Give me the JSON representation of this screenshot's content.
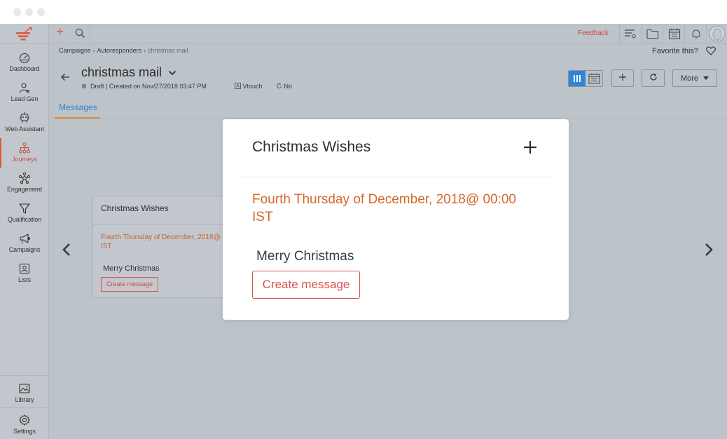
{
  "window": {},
  "sidebar": {
    "items": [
      {
        "label": "Dashboard",
        "icon": "dashboard-icon"
      },
      {
        "label": "Lead Gen",
        "icon": "lead-gen-icon"
      },
      {
        "label": "Web Assistant",
        "icon": "web-assistant-icon"
      },
      {
        "label": "Journeys",
        "icon": "journeys-icon",
        "active": true
      },
      {
        "label": "Engagement",
        "icon": "engagement-icon"
      },
      {
        "label": "Qualification",
        "icon": "funnel-icon"
      },
      {
        "label": "Campaigns",
        "icon": "megaphone-icon"
      },
      {
        "label": "Lists",
        "icon": "lists-icon"
      }
    ],
    "bottom": [
      {
        "label": "Library",
        "icon": "image-icon"
      },
      {
        "label": "Settings",
        "icon": "gear-icon"
      }
    ]
  },
  "topbar": {
    "feedback": "Feedback",
    "icons": [
      "plus-icon",
      "search-icon",
      "filter-list-icon",
      "folder-icon",
      "calendar-icon",
      "bell-icon",
      "avatar"
    ]
  },
  "breadcrumb": {
    "items": [
      "Campaigns",
      "Autoresponders",
      "christmas mail"
    ],
    "separator": "›"
  },
  "favorite": {
    "label": "Favorite this?"
  },
  "header": {
    "title": "christmas mail",
    "status": "Draft | Created on  Nov/27/2018 03:47 PM",
    "owner": "Vtouch",
    "recurring": "No",
    "more_label": "More"
  },
  "tabs": [
    {
      "label": "Messages",
      "active": true
    }
  ],
  "background_card": {
    "title": "Christmas Wishes",
    "schedule": "Fourth Thursday of December, 2018@ 00:00 IST",
    "message": "Merry Christmas",
    "create_label": "Create message"
  },
  "modal": {
    "title": "Christmas Wishes",
    "schedule": "Fourth Thursday of December, 2018@ 00:00 IST",
    "message": "Merry Christmas",
    "create_label": "Create message"
  },
  "colors": {
    "accent_blue": "#2e86d4",
    "accent_red": "#d9534f",
    "date_orange": "#d36a2a",
    "overlay_gray": "#bcc3c9"
  }
}
